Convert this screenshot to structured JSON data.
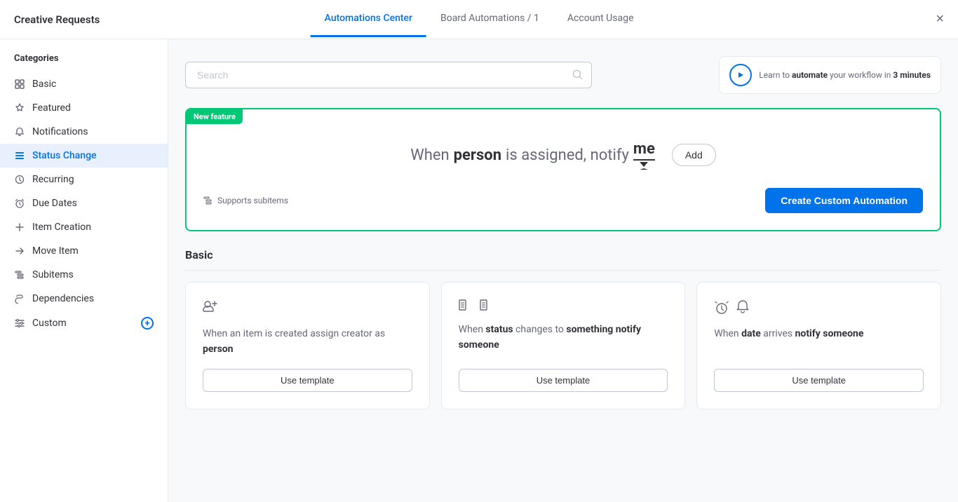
{
  "header": {
    "title": "Creative Requests",
    "tabs": [
      {
        "id": "automations-center",
        "label": "Automations Center",
        "active": true
      },
      {
        "id": "board-automations",
        "label": "Board Automations / 1",
        "active": false
      },
      {
        "id": "account-usage",
        "label": "Account Usage",
        "active": false
      }
    ],
    "close_label": "×"
  },
  "sidebar": {
    "heading": "Categories",
    "items": [
      {
        "id": "basic",
        "label": "Basic",
        "icon": "grid"
      },
      {
        "id": "featured",
        "label": "Featured",
        "icon": "star"
      },
      {
        "id": "notifications",
        "label": "Notifications",
        "icon": "bell"
      },
      {
        "id": "status-change",
        "label": "Status Change",
        "icon": "list",
        "active": true
      },
      {
        "id": "recurring",
        "label": "Recurring",
        "icon": "clock"
      },
      {
        "id": "due-dates",
        "label": "Due Dates",
        "icon": "alarm"
      },
      {
        "id": "item-creation",
        "label": "Item Creation",
        "icon": "plus"
      },
      {
        "id": "move-item",
        "label": "Move Item",
        "icon": "arrow"
      },
      {
        "id": "subitems",
        "label": "Subitems",
        "icon": "subitems"
      },
      {
        "id": "dependencies",
        "label": "Dependencies",
        "icon": "hook"
      },
      {
        "id": "custom",
        "label": "Custom",
        "icon": "sliders"
      }
    ]
  },
  "search": {
    "placeholder": "Search"
  },
  "learn_box": {
    "text_before": "Learn to ",
    "bold1": "automate",
    "text_mid": " your workflow in ",
    "bold2": "3 minutes"
  },
  "custom_panel": {
    "badge": "New feature",
    "sentence_part1": "When",
    "bold1": "person",
    "sentence_part2": "is assigned,  notify",
    "bold2": "me",
    "add_button": "Add",
    "supports_label": "Supports subitems",
    "create_button": "Create Custom Automation"
  },
  "basic_section": {
    "title": "Basic",
    "cards": [
      {
        "id": "card-1",
        "text_plain": "When an item is created assign creator as ",
        "text_bold": "person",
        "use_label": "Use template"
      },
      {
        "id": "card-2",
        "text_plain1": "When ",
        "text_bold1": "status",
        "text_plain2": " changes to ",
        "text_bold2": "something notify someone",
        "use_label": "Use template"
      },
      {
        "id": "card-3",
        "text_plain1": "When ",
        "text_bold1": "date",
        "text_plain2": " arrives ",
        "text_bold2": "notify someone",
        "use_label": "Use template"
      }
    ]
  }
}
